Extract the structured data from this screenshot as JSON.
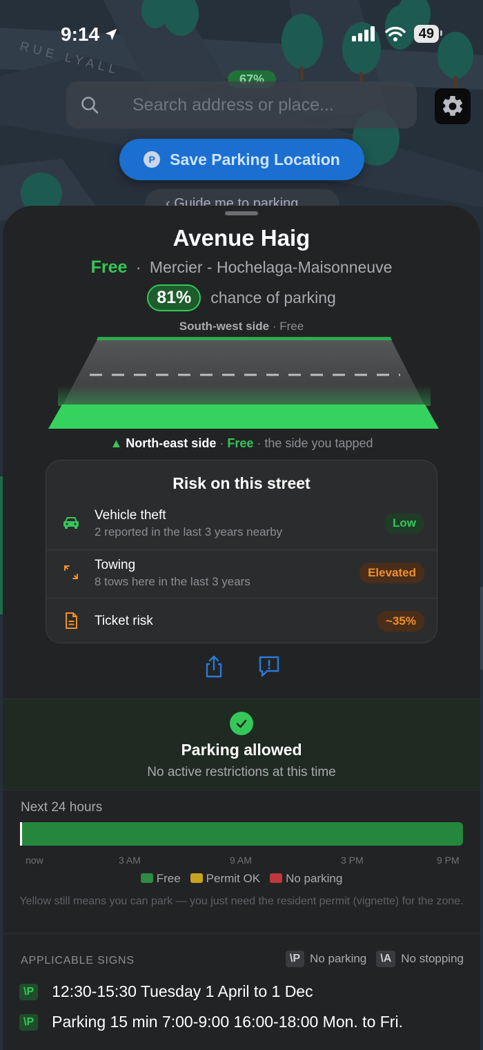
{
  "status_bar": {
    "time": "9:14",
    "battery": "49"
  },
  "map": {
    "street_label": "RUE LYALL",
    "chip_percent": "67%"
  },
  "search": {
    "placeholder": "Search address or place..."
  },
  "save_button": {
    "label": "Save Parking Location",
    "icon_letter": "P"
  },
  "guide_pill": {
    "label": "‹ Guide me to parking"
  },
  "sheet": {
    "title": "Avenue Haig",
    "price": "Free",
    "separator": "·",
    "neighbourhood": "Mercier - Hochelaga-Maisonneuve",
    "chance_percent": "81%",
    "chance_text": "chance of parking",
    "top_side": {
      "name": "South-west side",
      "status": "Free"
    },
    "bottom_side": {
      "marker": "▲",
      "name": "North-east side",
      "status": "Free",
      "note": "the side you tapped"
    },
    "risk": {
      "title": "Risk on this street",
      "rows": [
        {
          "title": "Vehicle theft",
          "subtitle": "2 reported in the last 3 years nearby",
          "level": "Low"
        },
        {
          "title": "Towing",
          "subtitle": "8 tows here in the last 3 years",
          "level": "Elevated"
        },
        {
          "title": "Ticket risk",
          "subtitle": "",
          "level": "~35%"
        }
      ]
    },
    "status": {
      "headline": "Parking allowed",
      "detail": "No active restrictions at this time"
    },
    "timeline": {
      "label": "Next 24 hours",
      "ticks": [
        "now",
        "3 AM",
        "9 AM",
        "3 PM",
        "9 PM"
      ],
      "legend": [
        {
          "label": "Free",
          "color": "#2f8a45"
        },
        {
          "label": "Permit OK",
          "color": "#c9a21f"
        },
        {
          "label": "No parking",
          "color": "#c0383c"
        }
      ],
      "note": "Yellow still means you can park — you just need the resident permit (vignette) for the zone."
    },
    "signs": {
      "header": "APPLICABLE SIGNS",
      "key": [
        {
          "code": "\\P",
          "label": "No parking"
        },
        {
          "code": "\\A",
          "label": "No stopping"
        }
      ],
      "items": [
        {
          "code": "\\P",
          "text": "12:30-15:30 Tuesday 1 April to 1 Dec"
        },
        {
          "code": "\\P",
          "text": "Parking 15 min 7:00-9:00 16:00-18:00 Mon. to Fri."
        }
      ]
    }
  },
  "colors": {
    "accent_green": "#35c759",
    "accent_blue": "#1a6fd1",
    "warning_orange": "#f0902c"
  }
}
